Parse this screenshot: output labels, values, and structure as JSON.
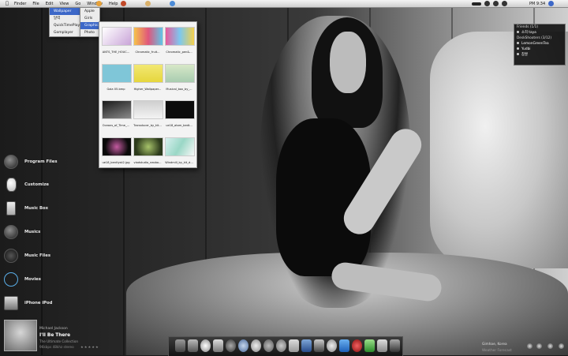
{
  "menubar": {
    "items": [
      "Finder",
      "File",
      "Edit",
      "View",
      "Go",
      "Window",
      "Help"
    ],
    "active_item": "Wallpaper",
    "clock": "PM 9:34"
  },
  "menu_main": {
    "items": [
      "Wallpaper",
      "달력",
      "QuickTimePlayer",
      "Gomplayer"
    ]
  },
  "menu_sub": {
    "items": [
      "Apple",
      "Girls",
      "Graphical",
      "Photo"
    ],
    "selected": "Graphical"
  },
  "stack": {
    "files": [
      "ANTS_THE_HOUC...",
      "Chromatic_fruit...",
      "Chromatic_pen&...",
      "Gaia 05.bmp",
      "Higher_Wallpaper...",
      "Musical_box_by_...",
      "Oceans_of_Time_...",
      "Transducer_by_kit...",
      "ue18_atom_bedt...",
      "ue18_bentlysk2.jpg",
      "viadstudio_neobo...",
      "Windmill_by_kit_d..."
    ]
  },
  "launcher": {
    "items": [
      "Program Files",
      "Customize",
      "Music Box",
      "Musics",
      "Music Files",
      "Movies",
      "iPhone iPod"
    ]
  },
  "friends": {
    "header": "Friends (1/1)",
    "list1": [
      "소희 taya"
    ],
    "header2": "DeskShooters (3/12)",
    "list2": [
      "LemonGreenTea",
      "Yudbi",
      "찹쌀"
    ]
  },
  "now_playing": {
    "artist": "Michael Jackson",
    "title": "I'll Be There",
    "album": "The Ultimate Collection",
    "info": "96kbps 48khz stereo",
    "rating": "★★★★★"
  },
  "weather": {
    "city": "Gimhae, Korea",
    "condition": "Weather Forecast"
  },
  "colors": {
    "menu_highlight": "#3d68c8",
    "menubar_bg": "#e4e4e4",
    "widget_bg": "#0a0a0a"
  }
}
